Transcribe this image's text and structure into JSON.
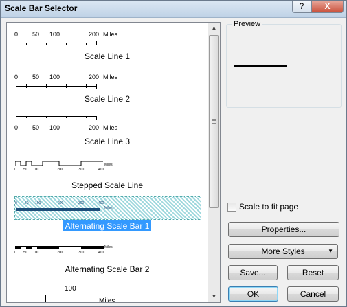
{
  "window": {
    "title": "Scale Bar Selector",
    "help_glyph": "?",
    "close_glyph": "X"
  },
  "list": {
    "items": [
      {
        "label": "Scale Line 1",
        "ticks": [
          "0",
          "50",
          "100",
          "200",
          "Miles"
        ]
      },
      {
        "label": "Scale Line 2",
        "ticks": [
          "0",
          "50",
          "100",
          "200",
          "Miles"
        ]
      },
      {
        "label": "Scale Line 3",
        "ticks": [
          "0",
          "50",
          "100",
          "200",
          "Miles"
        ]
      },
      {
        "label": "Stepped Scale Line",
        "ticks": [
          "0",
          "50",
          "100",
          "200",
          "300",
          "400",
          "Miles"
        ]
      },
      {
        "label": "Alternating Scale Bar 1",
        "selected": true,
        "ticks": [
          "0",
          "50",
          "100",
          "200",
          "300",
          "400",
          "Miles"
        ]
      },
      {
        "label": "Alternating Scale Bar 2",
        "ticks": [
          "0",
          "50",
          "100",
          "200",
          "300",
          "400",
          "Miles"
        ]
      },
      {
        "label": "",
        "ticks": [
          "100",
          "Miles"
        ]
      }
    ],
    "scroll_up": "▲",
    "scroll_down": "▼"
  },
  "preview": {
    "legend": "Preview"
  },
  "options": {
    "scale_to_fit_label": "Scale to fit page",
    "scale_to_fit_checked": false
  },
  "buttons": {
    "properties": "Properties...",
    "more_styles": "More Styles",
    "more_styles_arrow": "▼",
    "save": "Save...",
    "reset": "Reset",
    "ok": "OK",
    "cancel": "Cancel"
  }
}
